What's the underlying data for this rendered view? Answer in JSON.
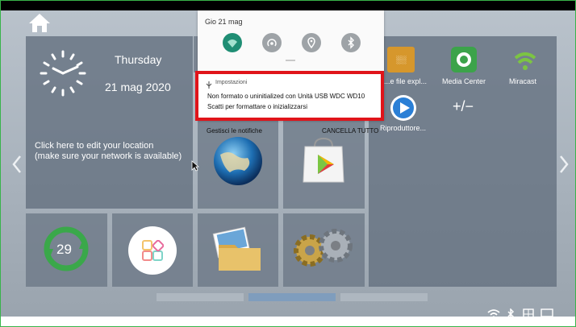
{
  "home": {
    "label": ""
  },
  "clock_widget": {
    "day": "Thursday",
    "date": "21 mag 2020",
    "location_line1": "Click here to edit your location",
    "location_line2": "(make sure your network is available)"
  },
  "notification_shade": {
    "date": "Gio 21 mag",
    "quick_settings": [
      "wifi-icon",
      "hotspot-icon",
      "location-icon",
      "bluetooth-icon"
    ],
    "manage_label": "Gestisci le notifiche",
    "clear_all_label": "CANCELLA TUTTO",
    "notification": {
      "app": "Impostazioni",
      "title": "Non formato o uninitialized con Unità USB WDC WD10",
      "text": "Scatti per formattare o inizializzarsi"
    }
  },
  "apps": [
    {
      "label": "...e file expl...",
      "icon": "file-explorer-icon"
    },
    {
      "label": "Media Center",
      "icon": "media-center-icon"
    },
    {
      "label": "Miracast",
      "icon": "miracast-icon"
    },
    {
      "label": "Riproduttore...",
      "icon": "video-player-icon"
    },
    {
      "label": "+/−",
      "icon": "add-remove-icon"
    }
  ],
  "cleaner_widget": {
    "value": "29"
  },
  "accent_colors": {
    "notification_highlight": "#e0141a",
    "wifi_active": "#1f8e74",
    "frame": "#38b44a"
  }
}
